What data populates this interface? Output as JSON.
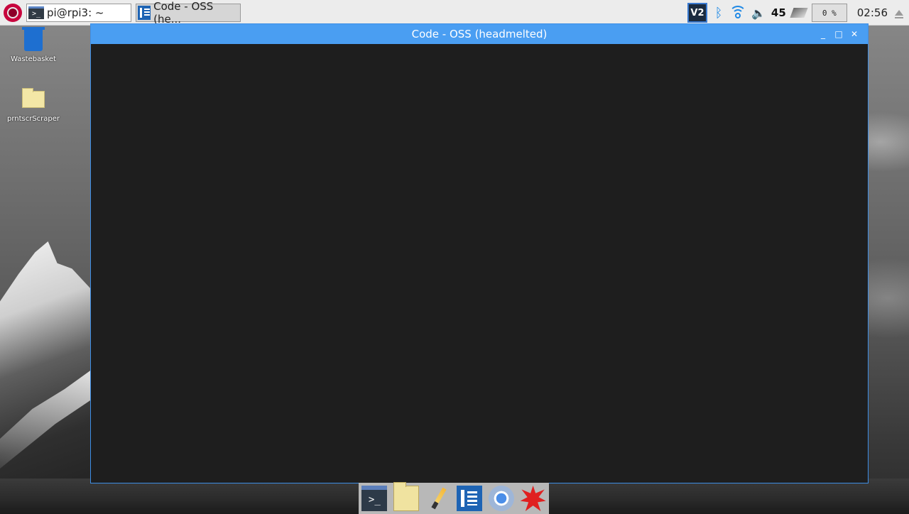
{
  "panel": {
    "tasks": [
      {
        "icon": "terminal-icon",
        "label": "pi@rpi3: ~"
      },
      {
        "icon": "code-oss-icon",
        "label": "Code - OSS (he..."
      }
    ],
    "tray": {
      "vnc_label": "V2",
      "temperature": "45",
      "cpu_usage": "0 %",
      "clock": "02:56"
    }
  },
  "desktop": {
    "icons": [
      {
        "icon": "wastebasket-icon",
        "label": "Wastebasket"
      },
      {
        "icon": "folder-icon",
        "label": "prntscrScraper"
      }
    ]
  },
  "window": {
    "title": "Code - OSS (headmelted)",
    "controls": {
      "minimize": "_",
      "maximize": "□",
      "close": "✕"
    }
  },
  "dock": {
    "items": [
      "terminal-icon",
      "file-manager-icon",
      "text-editor-icon",
      "code-oss-icon",
      "chromium-icon",
      "wolfram-icon"
    ]
  },
  "colors": {
    "titlebar": "#4a9ef2",
    "editor_bg": "#1e1e1e",
    "panel_bg": "#ececec"
  }
}
